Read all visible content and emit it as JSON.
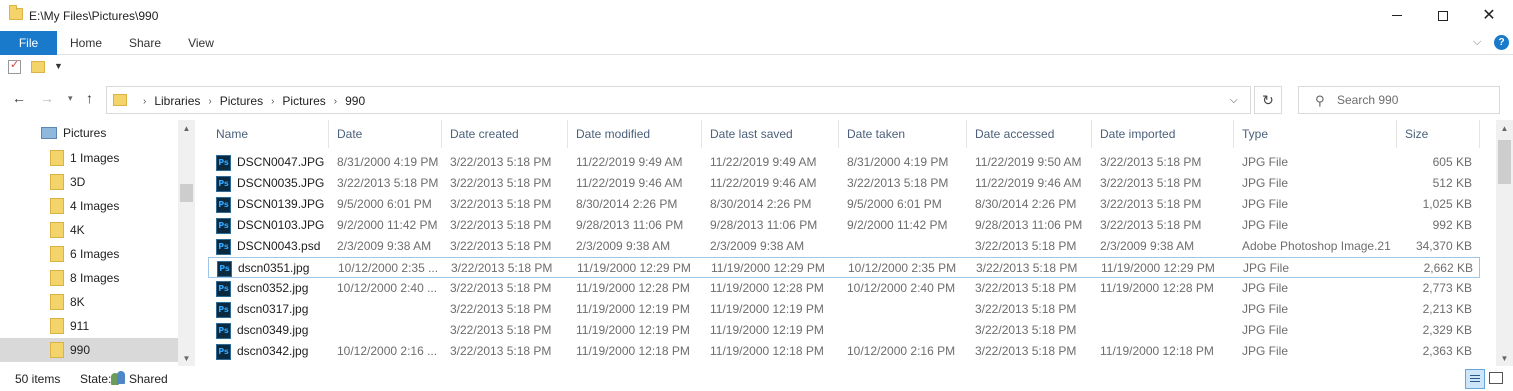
{
  "window": {
    "title": "E:\\My Files\\Pictures\\990",
    "minimize": "—",
    "maximize": "☐",
    "close": "✕"
  },
  "ribbon": {
    "tabs": [
      "File",
      "Home",
      "Share",
      "View"
    ],
    "help": "?"
  },
  "address": {
    "crumbs": [
      "Libraries",
      "Pictures",
      "Pictures",
      "990"
    ],
    "separator": "›"
  },
  "search": {
    "placeholder": "Search 990"
  },
  "nav_tree": {
    "root": "Pictures",
    "items": [
      "1 Images",
      "3D",
      "4 Images",
      "4K",
      "6 Images",
      "8 Images",
      "8K",
      "911",
      "990"
    ],
    "selected": "990"
  },
  "columns": [
    "Name",
    "Date",
    "Date created",
    "Date modified",
    "Date last saved",
    "Date taken",
    "Date accessed",
    "Date imported",
    "Type",
    "Size"
  ],
  "files": [
    {
      "name": "DSCN0047.JPG",
      "date": "8/31/2000 4:19 PM",
      "created": "3/22/2013 5:18 PM",
      "modified": "11/22/2019 9:49 AM",
      "last_saved": "11/22/2019 9:49 AM",
      "taken": "8/31/2000 4:19 PM",
      "accessed": "11/22/2019 9:50 AM",
      "imported": "3/22/2013 5:18 PM",
      "type": "JPG File",
      "size": "605 KB"
    },
    {
      "name": "DSCN0035.JPG",
      "date": "3/22/2013 5:18 PM",
      "created": "3/22/2013 5:18 PM",
      "modified": "11/22/2019 9:46 AM",
      "last_saved": "11/22/2019 9:46 AM",
      "taken": "3/22/2013 5:18 PM",
      "accessed": "11/22/2019 9:46 AM",
      "imported": "3/22/2013 5:18 PM",
      "type": "JPG File",
      "size": "512 KB"
    },
    {
      "name": "DSCN0139.JPG",
      "date": "9/5/2000 6:01 PM",
      "created": "3/22/2013 5:18 PM",
      "modified": "8/30/2014 2:26 PM",
      "last_saved": "8/30/2014 2:26 PM",
      "taken": "9/5/2000 6:01 PM",
      "accessed": "8/30/2014 2:26 PM",
      "imported": "3/22/2013 5:18 PM",
      "type": "JPG File",
      "size": "1,025 KB"
    },
    {
      "name": "DSCN0103.JPG",
      "date": "9/2/2000 11:42 PM",
      "created": "3/22/2013 5:18 PM",
      "modified": "9/28/2013 11:06 PM",
      "last_saved": "9/28/2013 11:06 PM",
      "taken": "9/2/2000 11:42 PM",
      "accessed": "9/28/2013 11:06 PM",
      "imported": "3/22/2013 5:18 PM",
      "type": "JPG File",
      "size": "992 KB"
    },
    {
      "name": "DSCN0043.psd",
      "date": "2/3/2009 9:38 AM",
      "created": "3/22/2013 5:18 PM",
      "modified": "2/3/2009 9:38 AM",
      "last_saved": "2/3/2009 9:38 AM",
      "taken": "",
      "accessed": "3/22/2013 5:18 PM",
      "imported": "2/3/2009 9:38 AM",
      "type": "Adobe Photoshop Image.21",
      "size": "34,370 KB"
    },
    {
      "name": "dscn0351.jpg",
      "date": "10/12/2000 2:35 ...",
      "created": "3/22/2013 5:18 PM",
      "modified": "11/19/2000 12:29 PM",
      "last_saved": "11/19/2000 12:29 PM",
      "taken": "10/12/2000 2:35 PM",
      "accessed": "3/22/2013 5:18 PM",
      "imported": "11/19/2000 12:29 PM",
      "type": "JPG File",
      "size": "2,662 KB",
      "focused": true
    },
    {
      "name": "dscn0352.jpg",
      "date": "10/12/2000 2:40 ...",
      "created": "3/22/2013 5:18 PM",
      "modified": "11/19/2000 12:28 PM",
      "last_saved": "11/19/2000 12:28 PM",
      "taken": "10/12/2000 2:40 PM",
      "accessed": "3/22/2013 5:18 PM",
      "imported": "11/19/2000 12:28 PM",
      "type": "JPG File",
      "size": "2,773 KB"
    },
    {
      "name": "dscn0317.jpg",
      "date": "",
      "created": "3/22/2013 5:18 PM",
      "modified": "11/19/2000 12:19 PM",
      "last_saved": "11/19/2000 12:19 PM",
      "taken": "",
      "accessed": "3/22/2013 5:18 PM",
      "imported": "",
      "type": "JPG File",
      "size": "2,213 KB"
    },
    {
      "name": "dscn0349.jpg",
      "date": "",
      "created": "3/22/2013 5:18 PM",
      "modified": "11/19/2000 12:19 PM",
      "last_saved": "11/19/2000 12:19 PM",
      "taken": "",
      "accessed": "3/22/2013 5:18 PM",
      "imported": "",
      "type": "JPG File",
      "size": "2,329 KB"
    },
    {
      "name": "dscn0342.jpg",
      "date": "10/12/2000 2:16 ...",
      "created": "3/22/2013 5:18 PM",
      "modified": "11/19/2000 12:18 PM",
      "last_saved": "11/19/2000 12:18 PM",
      "taken": "10/12/2000 2:16 PM",
      "accessed": "3/22/2013 5:18 PM",
      "imported": "11/19/2000 12:18 PM",
      "type": "JPG File",
      "size": "2,363 KB"
    }
  ],
  "status": {
    "count": "50 items",
    "state_label": "State:",
    "state_value": "Shared"
  },
  "icons": {
    "file": "ps-icon",
    "folder": "folder-icon",
    "sort": "sort-caret-icon"
  },
  "colors": {
    "accent": "#1979ca",
    "header_text": "#4c607a",
    "selected_bg": "#d9d9d9"
  }
}
